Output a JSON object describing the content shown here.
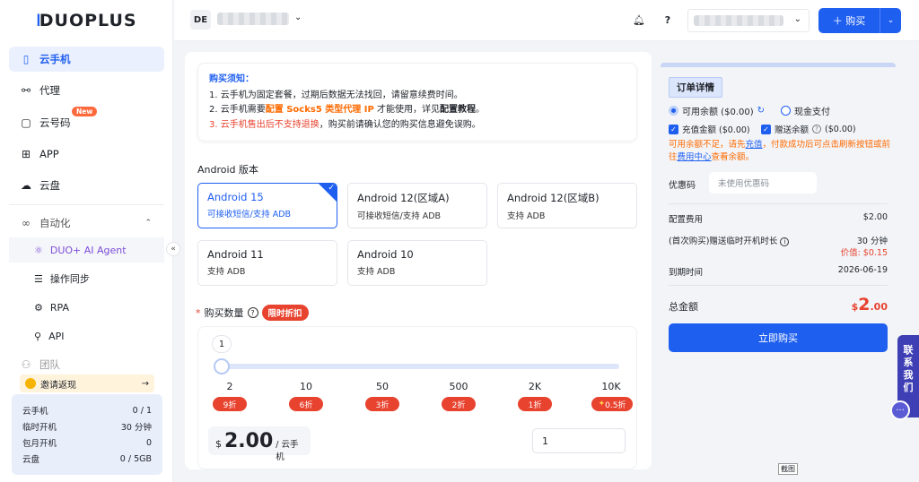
{
  "brand": {
    "logo_text": "DUOPLUS"
  },
  "sidebar": {
    "items": [
      {
        "label": "云手机",
        "icon": "phone-icon"
      },
      {
        "label": "代理",
        "icon": "proxy-icon"
      },
      {
        "label": "云号码",
        "icon": "number-icon",
        "badge": "New"
      },
      {
        "label": "APP",
        "icon": "app-grid-icon"
      },
      {
        "label": "云盘",
        "icon": "cloud-icon"
      }
    ],
    "automation": {
      "label": "自动化",
      "children": [
        "DUO+ AI Agent",
        "操作同步",
        "RPA",
        "API"
      ]
    },
    "team_label": "团队",
    "invite": {
      "label": "邀请返现"
    },
    "stats": [
      {
        "label": "云手机",
        "value": "0 / 1"
      },
      {
        "label": "临时开机",
        "value": "30 分钟"
      },
      {
        "label": "包月开机",
        "value": "0"
      },
      {
        "label": "云盘",
        "value": "0 / 5GB"
      }
    ]
  },
  "header": {
    "country": "DE",
    "buy_label": "购买"
  },
  "notice": {
    "title": "购买须知：",
    "line1": "1. 云手机为固定套餐，过期后数据无法找回，请留意续费时间。",
    "line2_a": "2. 云手机需要",
    "line2_b": "配置 Socks5 类型代理 IP",
    "line2_c": " 才能使用，详见",
    "line2_d": "配置教程",
    "line2_e": "。",
    "line3_a": "3. ",
    "line3_b": "云手机售出后不支持退换",
    "line3_c": "，购买前请确认您的购买信息避免误购。"
  },
  "android": {
    "section_label": "Android 版本",
    "versions": [
      {
        "name": "Android 15",
        "desc": "可接收短信/支持 ADB"
      },
      {
        "name": "Android 12(区域A)",
        "desc": "可接收短信/支持 ADB"
      },
      {
        "name": "Android 12(区域B)",
        "desc": "支持 ADB"
      },
      {
        "name": "Android 11",
        "desc": "支持 ADB"
      },
      {
        "name": "Android 10",
        "desc": "支持 ADB"
      }
    ]
  },
  "quantity": {
    "required_mark": "*",
    "label": "购买数量",
    "discount_tag": "限时折扣",
    "current": "1",
    "ticks": [
      {
        "label": "2",
        "badge": "9折"
      },
      {
        "label": "10",
        "badge": "6折"
      },
      {
        "label": "50",
        "badge": "3折"
      },
      {
        "label": "500",
        "badge": "2折"
      },
      {
        "label": "2K",
        "badge": "1折"
      },
      {
        "label": "10K",
        "badge": "0.5折"
      }
    ],
    "price_currency": "$",
    "price": "2.00",
    "price_unit": "/ 云手机",
    "input_value": "1"
  },
  "order": {
    "title": "订单详情",
    "balance_label": "可用余额 ($0.00)",
    "cash_label": "现金支付",
    "recharge_label": "充值金额 ($0.00)",
    "gift_label": "赠送余额",
    "gift_value": "($0.00)",
    "warn_a": "可用余额不足，请先",
    "warn_link1": "充值",
    "warn_b": "，付款成功后可点击刷新按钮或前往",
    "warn_link2": "费用中心",
    "warn_c": "查看余额。",
    "coupon_label": "优惠码",
    "coupon_placeholder": "未使用优惠码",
    "config_fee_label": "配置费用",
    "config_fee_value": "$2.00",
    "gift_time_label": "(首次购买)赠送临时开机时长",
    "gift_time_value": "30 分钟",
    "gift_time_price": "价值: $0.15",
    "expire_label": "到期时间",
    "expire_value": "2026-06-19",
    "total_label": "总金额",
    "total_currency": "$",
    "total_int": "2",
    "total_dec": ".00",
    "buy_now": "立即购买"
  },
  "contact": {
    "label": "联系我们"
  },
  "screenshot_tip": "截图",
  "colors": {
    "primary": "#1f5ff0",
    "danger": "#e8432f",
    "warning": "#ff6a00"
  }
}
